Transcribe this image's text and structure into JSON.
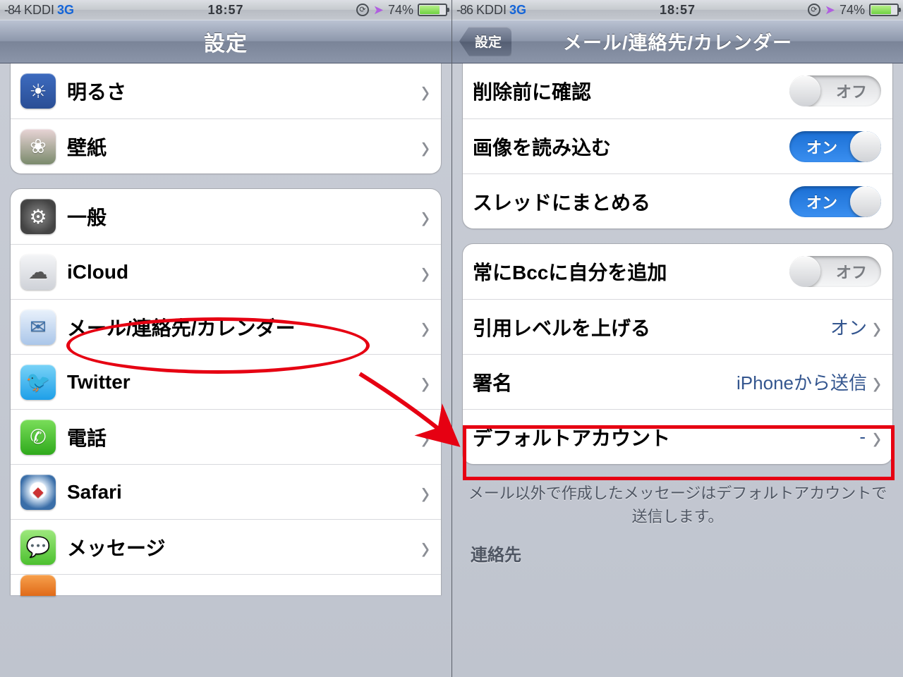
{
  "left": {
    "status": {
      "signal": "-84",
      "carrier": "KDDI",
      "network": "3G",
      "time": "18:57",
      "battery": "74%"
    },
    "nav": {
      "title": "設定"
    },
    "g1": [
      {
        "label": "明るさ"
      },
      {
        "label": "壁紙"
      }
    ],
    "g2": [
      {
        "label": "一般"
      },
      {
        "label": "iCloud"
      },
      {
        "label": "メール/連絡先/カレンダー"
      },
      {
        "label": "Twitter"
      },
      {
        "label": "電話"
      },
      {
        "label": "Safari"
      },
      {
        "label": "メッセージ"
      }
    ]
  },
  "right": {
    "status": {
      "signal": "-86",
      "carrier": "KDDI",
      "network": "3G",
      "time": "18:57",
      "battery": "74%"
    },
    "nav": {
      "back": "設定",
      "title": "メール/連絡先/カレンダー"
    },
    "g1": [
      {
        "label": "削除前に確認"
      },
      {
        "label": "画像を読み込む"
      },
      {
        "label": "スレッドにまとめる"
      }
    ],
    "g2": [
      {
        "label": "常にBccに自分を追加"
      },
      {
        "label": "引用レベルを上げる"
      },
      {
        "label": "署名"
      },
      {
        "label": "デフォルトアカウント"
      }
    ],
    "toggle": {
      "on": "オン",
      "off": "オフ"
    },
    "value_on": "オン",
    "signature_value": "iPhoneから送信",
    "footer": "メール以外で作成したメッセージはデフォルトアカウントで送信します。",
    "section": "連絡先"
  }
}
